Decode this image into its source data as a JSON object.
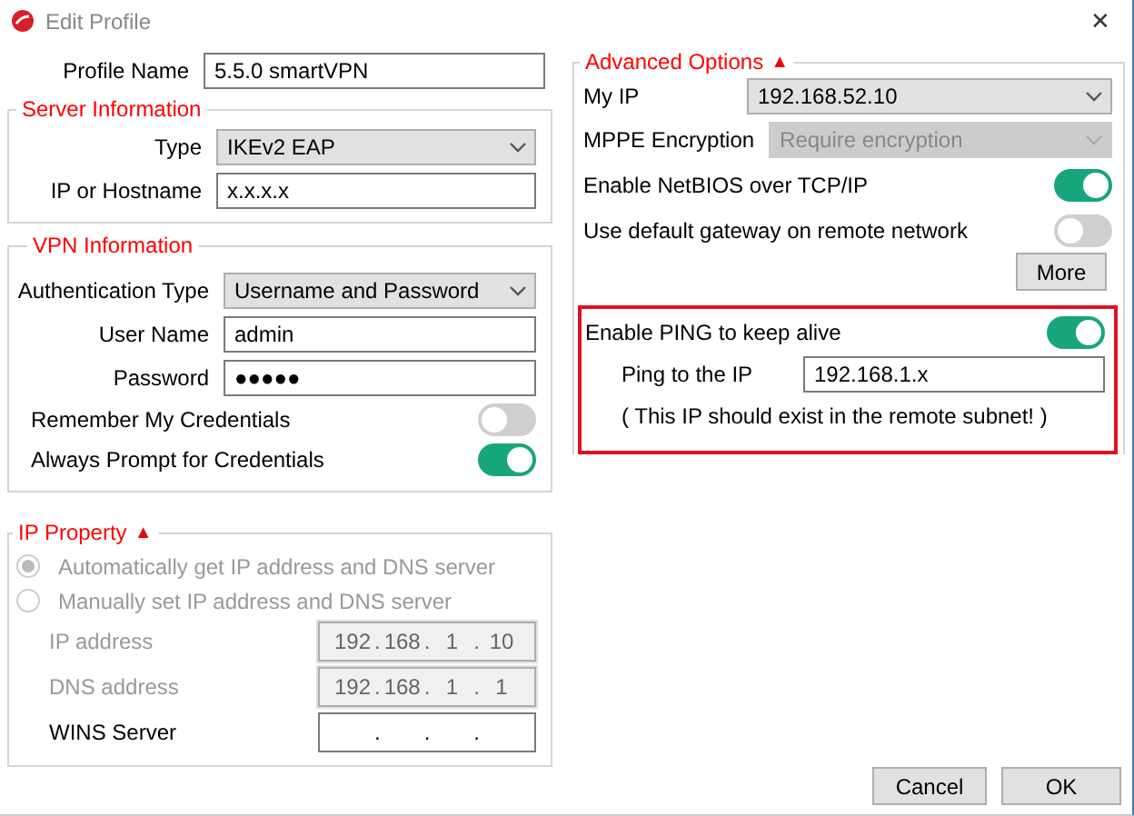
{
  "window": {
    "title": "Edit Profile",
    "close": "✕"
  },
  "profile_name": {
    "label": "Profile Name",
    "value": "5.5.0 smartVPN"
  },
  "server_information": {
    "title": "Server Information",
    "rows": [
      {
        "kind": "dropdown",
        "label": "Type",
        "value": "IKEv2 EAP",
        "disabled": false
      },
      {
        "kind": "text",
        "label": "IP or Hostname",
        "value": "x.x.x.x"
      }
    ]
  },
  "vpn_information": {
    "title": "VPN Information",
    "rows": [
      {
        "kind": "dropdown",
        "label": "Authentication Type",
        "value": "Username and Password",
        "disabled": false
      },
      {
        "kind": "text",
        "label": "User Name",
        "value": "admin"
      },
      {
        "kind": "text",
        "label": "Password",
        "value": "●●●●●"
      }
    ],
    "toggles": [
      {
        "label": "Remember My Credentials",
        "on": false
      },
      {
        "label": "Always Prompt for Credentials",
        "on": true
      }
    ]
  },
  "ip_property": {
    "title": "IP Property",
    "toggle": "▲",
    "options": [
      {
        "label": "Automatically get IP address and DNS server",
        "selected": true,
        "disabled": true
      },
      {
        "label": "Manually set IP address and DNS server",
        "selected": false,
        "disabled": true
      }
    ],
    "separator": ".",
    "fields": [
      {
        "label": "IP address",
        "octets": [
          "192",
          "168",
          "1",
          "10"
        ],
        "disabled": true
      },
      {
        "label": "DNS address",
        "octets": [
          "192",
          "168",
          "1",
          "1"
        ],
        "disabled": true
      },
      {
        "label": "WINS Server",
        "disabled": false
      }
    ]
  },
  "advanced_options": {
    "title": "Advanced Options",
    "toggle": "▲",
    "rows": [
      {
        "kind": "dropdown",
        "label": "My IP",
        "value": "192.168.52.10",
        "disabled": false
      },
      {
        "kind": "dropdown",
        "label": "MPPE Encryption",
        "value": "Require encryption",
        "disabled": true
      },
      {
        "kind": "switch",
        "label": "Enable NetBIOS over TCP/IP",
        "on": true
      },
      {
        "kind": "switch",
        "label": "Use default gateway on remote network",
        "on": false
      }
    ],
    "more_button": "More",
    "ping": {
      "label": "Enable PING to keep alive",
      "on": true,
      "ip_label": "Ping to the IP",
      "ip_value": "192.168.1.x",
      "note": "( This IP should exist in the remote subnet! )"
    }
  },
  "buttons": [
    "Cancel",
    "OK"
  ]
}
